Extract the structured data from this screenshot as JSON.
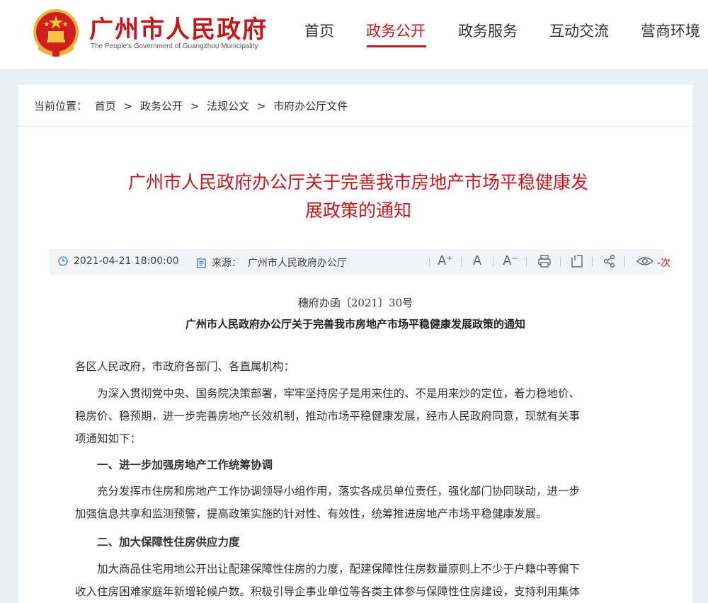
{
  "header": {
    "site_title": "广州市人民政府",
    "site_subtitle": "The People's Government of Guangzhou Municipality",
    "nav": [
      "首页",
      "政务公开",
      "政务服务",
      "互动交流",
      "营商环境"
    ],
    "active_nav": "政务公开"
  },
  "breadcrumb": {
    "prefix": "当前位置：",
    "items": [
      "首页",
      ">",
      "政务公开",
      ">",
      "法规公文",
      ">",
      "市府办公厅文件"
    ]
  },
  "article": {
    "title_line1": "广州市人民政府办公厅关于完善我市房地产市场平稳健康发",
    "title_line2": "展政策的通知",
    "date": "2021-04-21 18:00:00",
    "source_label": "来源：",
    "source": "广州市人民政府办公厅",
    "views": "-次",
    "tools": {
      "font_larger": "A⁺",
      "font_normal": "A",
      "font_smaller": "A⁻"
    },
    "doc_number": "穗府办函〔2021〕30号",
    "doc_title": "广州市人民政府办公厅关于完善我市房地产市场平稳健康发展政策的通知",
    "salutation": "各区人民政府，市政府各部门、各直属机构：",
    "intro_lines": [
      "　　为深入贯彻党中央、国务院决策部署，牢牢坚持房子是用来住的、不是用来炒的定位，着力稳地价、",
      "稳房价、稳预期，进一步完善房地产长效机制，推动市场平稳健康发展，经市人民政府同意，现就有关事",
      "项通知如下："
    ],
    "section1_heading": "　　一、进一步加强房地产工作统筹协调",
    "section1_lines": [
      "　　充分发挥市住房和房地产工作协调领导小组作用，落实各成员单位责任，强化部门协同联动，进一步",
      "加强信息共享和监测预警，提高政策实施的针对性、有效性，统筹推进房地产市场平稳健康发展。"
    ],
    "section2_heading": "　　二、加大保障性住房供应力度",
    "section2_lines": [
      "　　加大商品住宅用地公开出让配建保障性住房的力度，配建保障性住房数量原则上不少于户籍中等偏下",
      "收入住房困难家庭年新增轮候户数。积极引导企事业单位等各类主体参与保障性住房建设，支持利用集体"
    ]
  },
  "colors": {
    "brand_red": "#c4171c",
    "page_bg": "#e9eef3",
    "meta_bg": "#f2f3f5"
  }
}
